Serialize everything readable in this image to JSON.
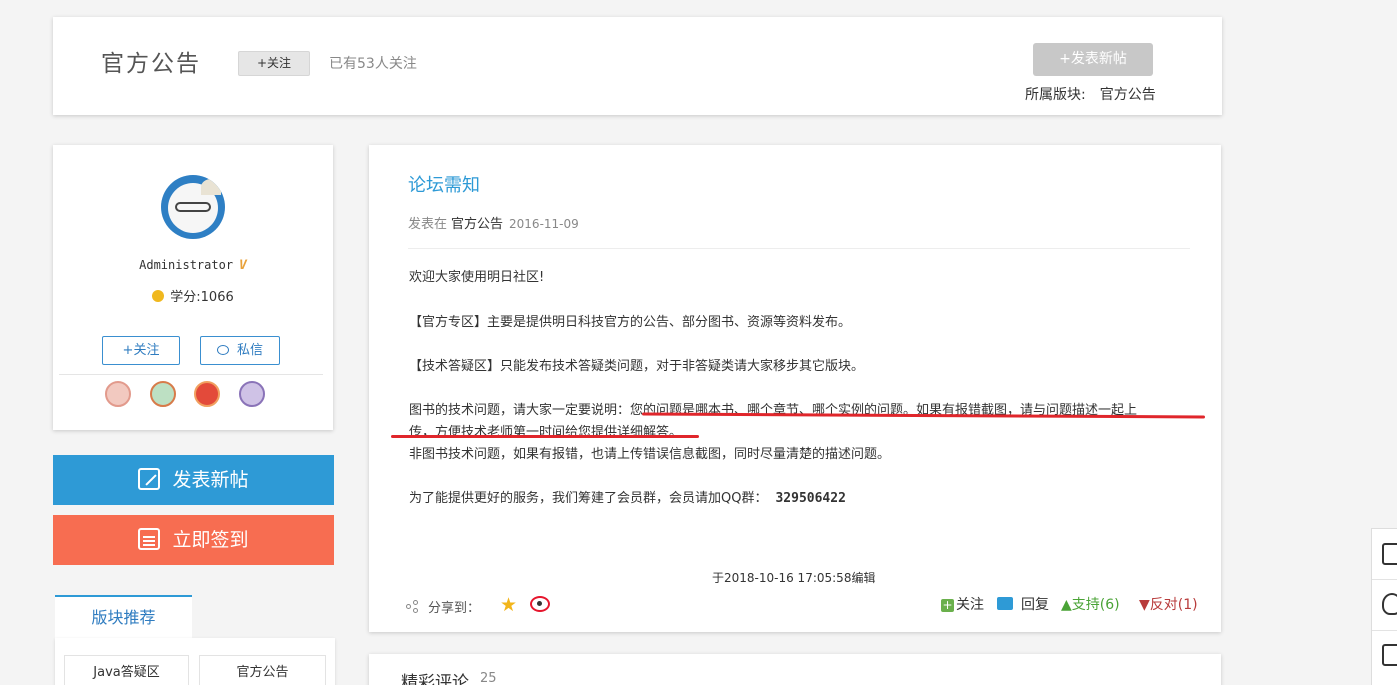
{
  "header": {
    "board_title": "官方公告",
    "follow_label": "+关注",
    "follower_text": "已有53人关注",
    "new_post_label": "+发表新帖",
    "belong_label": "所属版块:",
    "belong_value": "官方公告"
  },
  "user": {
    "name": "Administrator",
    "badge": "V",
    "score": "学分:1066",
    "follow_label": "+关注",
    "message_label": "私信",
    "medal_icons": [
      "medal-icon",
      "medal-icon",
      "medal-icon",
      "medal-icon"
    ]
  },
  "actions": {
    "big_post_label": "发表新帖",
    "big_sign_label": "立即签到"
  },
  "recommend": {
    "tab_label": "版块推荐",
    "items": [
      "Java答疑区",
      "官方公告"
    ]
  },
  "post": {
    "title": "论坛需知",
    "meta_prefix": "发表在",
    "meta_board": "官方公告",
    "meta_date": "2016-11-09",
    "paragraphs": {
      "p1": "欢迎大家使用明日社区!",
      "p2": "【官方专区】主要是提供明日科技官方的公告、部分图书、资源等资料发布。",
      "p3": "【技术答疑区】只能发布技术答疑类问题，对于非答疑类请大家移步其它版块。",
      "p4a": "图书的技术问题，请大家一定要说明：您的问题是哪本书、哪个章节、哪个实例的问题。如果有报错截图，请与问题描述一起上",
      "p4b": "传，方便技术老师第一时间给您提供详细解答。",
      "p5": "非图书技术问题，如果有报错，也请上传错误信息截图，同时尽量清楚的描述问题。",
      "p6": "为了能提供更好的服务，我们筹建了会员群，会员请加QQ群：",
      "qq": "329506422"
    },
    "edited": "于2018-10-16 17:05:58编辑",
    "share_label": "分享到：",
    "follow_label": "关注",
    "reply_label": "回复",
    "support_label": "支持(6)",
    "oppose_label": "反对(1)"
  },
  "comments": {
    "title": "精彩评论",
    "count": "25"
  },
  "colors": {
    "accent_blue": "#2e9ad6",
    "sign_orange": "#f76d51",
    "underline_red": "#e0262b",
    "support_green": "#4aa336",
    "oppose_red": "#b83b3b"
  }
}
